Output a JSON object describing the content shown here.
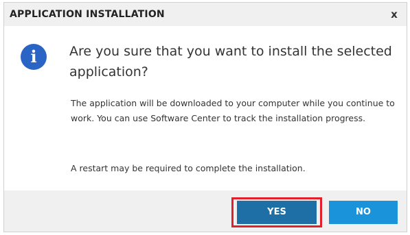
{
  "dialog": {
    "title": "APPLICATION INSTALLATION",
    "close_glyph": "x",
    "close_icon": "close-icon"
  },
  "content": {
    "icon": "info-icon",
    "icon_glyph": "i",
    "icon_color": "#2a64c5",
    "heading": "Are you sure that you want to install the selected application?",
    "body": "The application will be downloaded to your computer while you continue to work. You can use Software Center to track the installation progress.",
    "restart_note": "A restart may be required to complete the installation."
  },
  "buttons": {
    "yes_label": "YES",
    "no_label": "NO",
    "yes_color": "#1e6fa6",
    "no_color": "#1a93db"
  },
  "annotation": {
    "highlight_color": "#e0202a",
    "highlighted": "yes-button"
  }
}
